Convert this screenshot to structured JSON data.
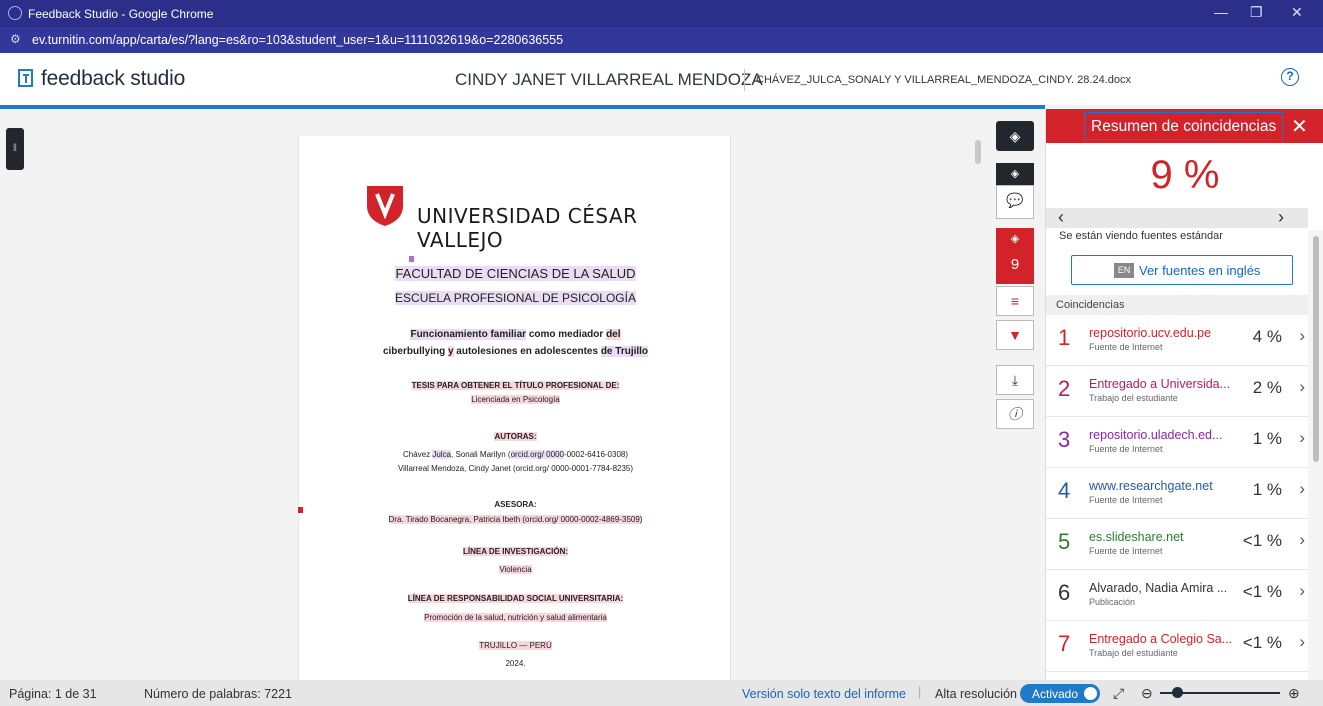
{
  "browser": {
    "window_title": "Feedback Studio - Google Chrome",
    "url": "ev.turnitin.com/app/carta/es/?lang=es&ro=103&student_user=1&u=1111032619&o=2280636555"
  },
  "header": {
    "logo_text": "feedback studio",
    "student_name": "CINDY JANET VILLARREAL MENDOZA",
    "file_name": "CHÁVEZ_JULCA_SONALY Y VILLARREAL_MENDOZA_CINDY. 28.24.docx",
    "help_symbol": "?"
  },
  "document": {
    "university": "UNIVERSIDAD CÉSAR VALLEJO",
    "faculty": "FACULTAD DE CIENCIAS DE LA SALUD",
    "school": "ESCUELA PROFESIONAL DE PSICOLOGÍA",
    "title_part1": "Funcionamiento familiar",
    "title_part2": " como mediador",
    "title_part3": "del",
    "title_line2_a": "ciberbullying ",
    "title_line2_b": "y",
    "title_line2_c": " autolesiones en adolescentes ",
    "title_line2_d": "de Trujillo",
    "thesis_label": "TESIS PARA OBTENER EL TÍTULO PROFESIONAL DE:",
    "degree": "Licenciada en Psicología",
    "authors_label": "AUTORAS:",
    "author1_a": "Chávez ",
    "author1_b": "Julca",
    "author1_c": ", Sonali Marilyn (",
    "author1_d": "orcid.org/ 0000",
    "author1_e": "-0002-6416-0308)",
    "author2": "Villarreal Mendoza, Cindy Janet (orcid.org/ 0000-0001-7784-8235)",
    "advisor_label": "ASESORA:",
    "advisor": "Dra. Tirado Bocanegra, Patricia Ibeth (orcid.org/ 0000-0002-4869-3509)",
    "research_line_label": "LÍNEA DE INVESTIGACIÓN:",
    "research_line": "Violencia",
    "social_line_label": "LÍNEA DE RESPONSABILIDAD SOCIAL UNIVERSITARIA:",
    "social_line": "Promoción de la salud, nutrición y salud alimentaria",
    "city": "TRUJILLO — PERÚ",
    "year": "2024."
  },
  "toolbar": {
    "similarity_count": "9"
  },
  "panel": {
    "title": "Resumen de coincidencias",
    "overall_percent": "9 %",
    "viewing_text": "Se están viendo fuentes estándar",
    "english_badge": "EN",
    "english_button": "Ver fuentes en inglés",
    "matches_header": "Coincidencias",
    "matches": [
      {
        "num": "1",
        "source": "repositorio.ucv.edu.pe",
        "type": "Fuente de Internet",
        "percent": "4 %",
        "color": "#d2232a"
      },
      {
        "num": "2",
        "source": "Entregado a Universida...",
        "type": "Trabajo del estudiante",
        "percent": "2 %",
        "color": "#c2185b"
      },
      {
        "num": "3",
        "source": "repositorio.uladech.ed...",
        "type": "Fuente de Internet",
        "percent": "1 %",
        "color": "#8e24aa"
      },
      {
        "num": "4",
        "source": "www.researchgate.net",
        "type": "Fuente de Internet",
        "percent": "1 %",
        "color": "#1e5fa8"
      },
      {
        "num": "5",
        "source": "es.slideshare.net",
        "type": "Fuente de Internet",
        "percent": "<1 %",
        "color": "#2e7d32"
      },
      {
        "num": "6",
        "source": "Alvarado, Nadia Amira ...",
        "type": "Publicación",
        "percent": "<1 %",
        "color": "#333333"
      },
      {
        "num": "7",
        "source": "Entregado a Colegio Sa...",
        "type": "Trabajo del estudiante",
        "percent": "<1 %",
        "color": "#d2232a"
      }
    ]
  },
  "status": {
    "page": "Página: 1 de 31",
    "word_count": "Número de palabras: 7221",
    "text_only_link": "Versión solo texto del informe",
    "high_res_label": "Alta resolución",
    "high_res_state": "Activado"
  }
}
